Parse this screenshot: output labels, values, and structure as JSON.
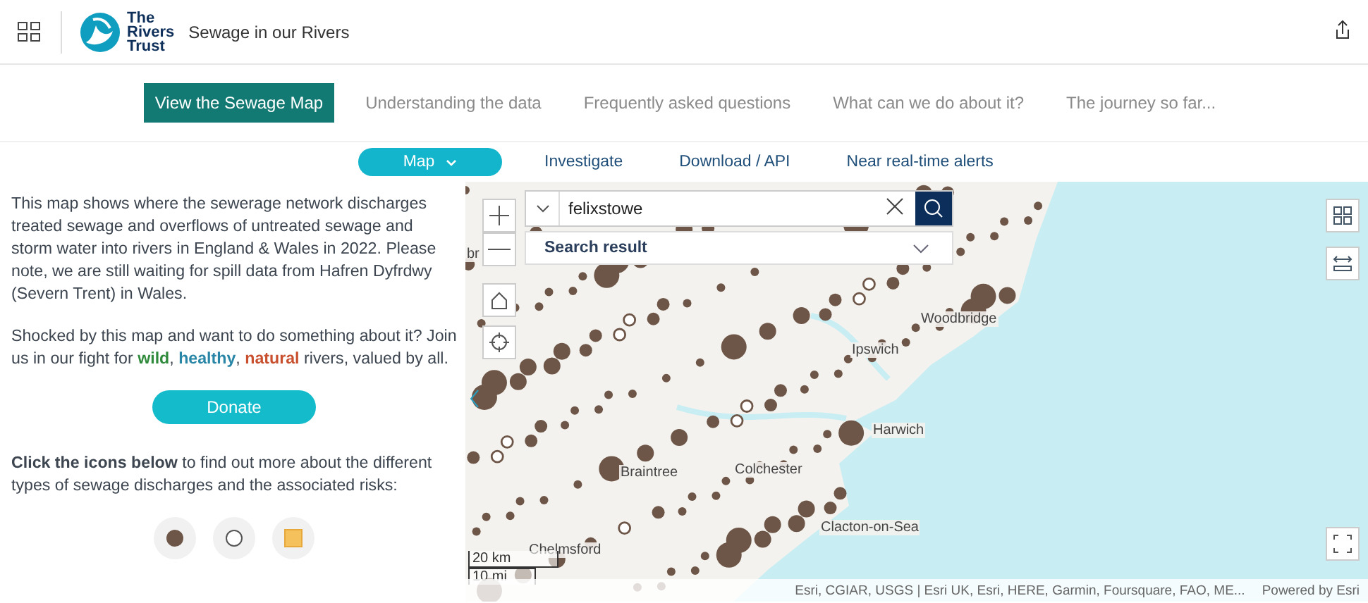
{
  "header": {
    "brand": [
      "The",
      "Rivers",
      "Trust"
    ],
    "title": "Sewage in our Rivers"
  },
  "nav": [
    {
      "label": "View the Sewage Map",
      "selected": true
    },
    {
      "label": "Understanding the data",
      "selected": false
    },
    {
      "label": "Frequently asked questions",
      "selected": false
    },
    {
      "label": "What can we do about it?",
      "selected": false
    },
    {
      "label": "The journey so far...",
      "selected": false
    }
  ],
  "tabs": [
    {
      "label": "Map",
      "selected": true,
      "dropdown": true
    },
    {
      "label": "Investigate",
      "selected": false,
      "dropdown": false
    },
    {
      "label": "Download / API",
      "selected": false,
      "dropdown": false
    },
    {
      "label": "Near real-time alerts",
      "selected": false,
      "dropdown": false
    }
  ],
  "sidebar": {
    "intro": "This map shows where the sewerage network discharges treated sewage and overflows of untreated sewage and storm water into rivers in England & Wales in 2022. Please note, we are still waiting for spill data from Hafren Dyfrdwy (Severn Trent) in Wales.",
    "appeal": [
      {
        "text": "Shocked by this map and want to do something about it? Join us in our fight for ",
        "kind": "plain"
      },
      {
        "text": "wild",
        "kind": "highlight",
        "color": "#2f8a3c"
      },
      {
        "text": ", ",
        "kind": "plain"
      },
      {
        "text": "healthy",
        "kind": "highlight",
        "color": "#2a86a6"
      },
      {
        "text": ", ",
        "kind": "plain"
      },
      {
        "text": "natural",
        "kind": "highlight",
        "color": "#c8502e"
      },
      {
        "text": " rivers, valued by all.",
        "kind": "plain"
      }
    ],
    "donate": "Donate",
    "instructions": "**Click the icons below** to find out more about the different types of sewage discharges and the associated risks:",
    "legend": [
      {
        "kind": "filled-dot"
      },
      {
        "kind": "hollow-dot"
      },
      {
        "kind": "square"
      }
    ]
  },
  "map": {
    "search": {
      "value": "felixstowe",
      "result": "Search result"
    },
    "places": [
      "Ipswich",
      "Woodbridge",
      "Harwich",
      "Colchester",
      "Braintree",
      "Clacton-on-Sea",
      "Chelmsford",
      "br"
    ],
    "scale": [
      "20 km",
      "10 mi"
    ],
    "attribution": "Esri, CGIAR, USGS | Esri UK, Esri, HERE, Garmin, Foursquare, FAO, ME...",
    "powered": "Powered by Esri"
  }
}
